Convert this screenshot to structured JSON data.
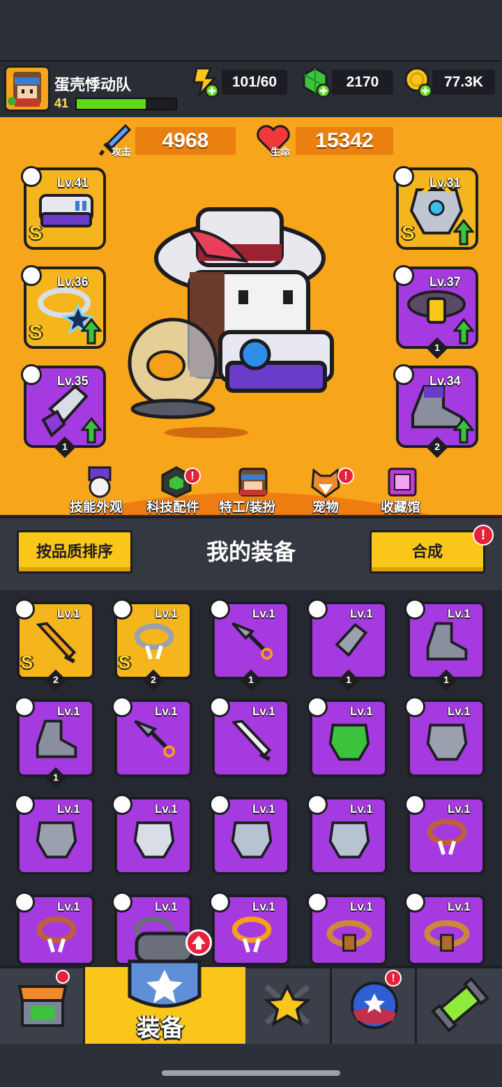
{
  "player": {
    "name": "蛋壳悸动队",
    "level": "41",
    "xp_fraction": 0.7
  },
  "resources": {
    "energy": "101/60",
    "gems": "2170",
    "coins": "77.3K"
  },
  "stats": {
    "attack_label": "攻击",
    "attack_value": "4968",
    "hp_label": "生命",
    "hp_value": "15342"
  },
  "equipped": {
    "weapon": {
      "level": "Lv.41",
      "grade": "S"
    },
    "armor": {
      "level": "Lv.31",
      "grade": "S"
    },
    "necklace": {
      "level": "Lv.36",
      "grade": "S"
    },
    "belt": {
      "level": "Lv.37",
      "count": "1"
    },
    "gloves": {
      "level": "Lv.35",
      "count": "1"
    },
    "boots": {
      "level": "Lv.34",
      "count": "2"
    }
  },
  "menu": [
    "技能外观",
    "科技配件",
    "特工/装扮",
    "宠物",
    "收藏馆"
  ],
  "badges": {
    "alert": "!"
  },
  "equipment_panel": {
    "sort_button": "按品质排序",
    "title": "我的装备",
    "merge_button": "合成"
  },
  "grid": {
    "level_label": "Lv.1",
    "items": [
      {
        "type": "sword",
        "grade": "S",
        "count": "2"
      },
      {
        "type": "necklace",
        "grade": "S",
        "count": "2"
      },
      {
        "type": "kunai",
        "count": "1"
      },
      {
        "type": "gloves",
        "count": "1"
      },
      {
        "type": "boots",
        "count": "1"
      },
      {
        "type": "boots",
        "count": "1"
      },
      {
        "type": "kunai"
      },
      {
        "type": "machete"
      },
      {
        "type": "armor-green"
      },
      {
        "type": "armor-gem"
      },
      {
        "type": "armor-gem"
      },
      {
        "type": "armor-plate"
      },
      {
        "type": "armor-steel"
      },
      {
        "type": "armor-steel"
      },
      {
        "type": "fang-necklace"
      },
      {
        "type": "fang-necklace"
      },
      {
        "type": "chain-necklace"
      },
      {
        "type": "lantern-necklace"
      },
      {
        "type": "rope-belt"
      },
      {
        "type": "rope-belt"
      }
    ]
  },
  "nav": {
    "active_label": "装备",
    "tabs": [
      "shop-icon",
      "equipment-icon",
      "talent-icon",
      "ball-icon",
      "evolve-icon"
    ]
  },
  "colors": {
    "orange_bg": "#f7a51a",
    "purple_item": "#a43ae0",
    "gold_item": "#f5b51c",
    "alert_red": "#e8203a",
    "xp_green": "#5fd81b"
  }
}
